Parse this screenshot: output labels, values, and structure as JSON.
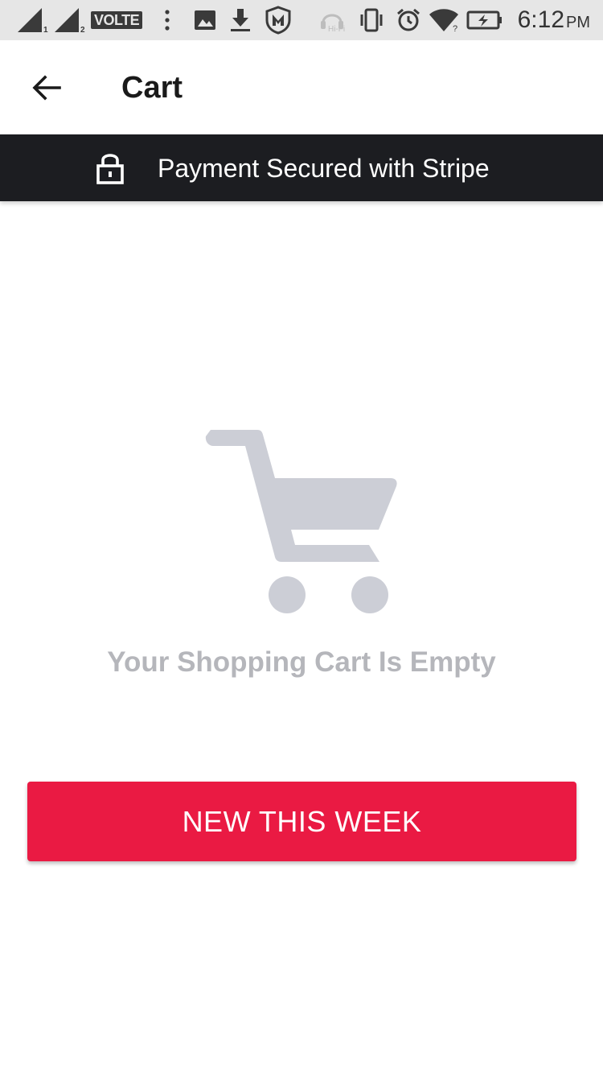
{
  "status_bar": {
    "network_label": "VOLTE",
    "sim1_index": "1",
    "sim2_index": "2",
    "hifi_label": "Hi-Fi",
    "time": "6:12",
    "ampm": "PM",
    "icons": [
      "signal-sim1-icon",
      "signal-sim2-icon",
      "more-dots-icon",
      "gallery-notification-icon",
      "download-icon",
      "mcafee-shield-icon",
      "hifi-headphones-icon",
      "vibrate-icon",
      "alarm-icon",
      "wifi-icon",
      "battery-charging-icon"
    ]
  },
  "app_bar": {
    "title": "Cart",
    "back_icon": "arrow-left-icon"
  },
  "banner": {
    "text": "Payment Secured with Stripe",
    "icon": "lock-icon"
  },
  "empty_state": {
    "icon": "shopping-cart-icon",
    "message": "Your Shopping Cart Is Empty"
  },
  "cta": {
    "label": "NEW THIS WEEK"
  },
  "colors": {
    "status_bar_bg": "#e6e6e6",
    "banner_bg": "#1c1d21",
    "cart_icon": "#ccced6",
    "empty_text": "#b5b6bb",
    "accent": "#ea1a43"
  }
}
